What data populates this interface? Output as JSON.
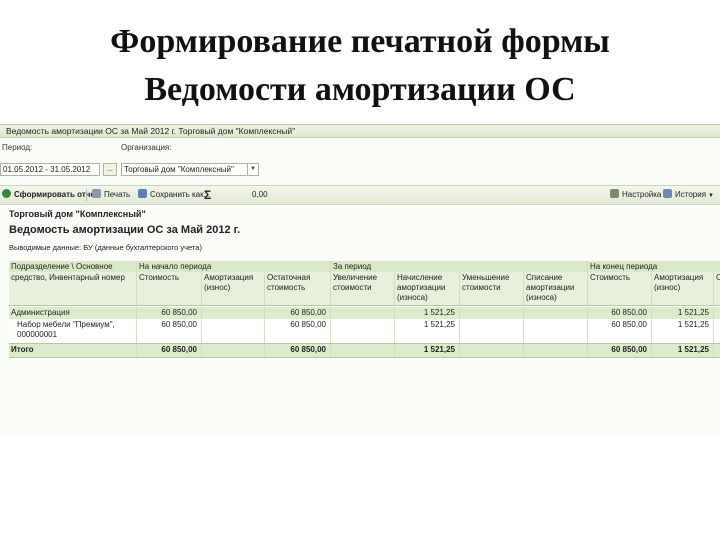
{
  "slide": {
    "title_line1": "Формирование печатной формы",
    "title_line2": "Ведомости амортизации ОС"
  },
  "window": {
    "title": "Ведомость амортизации ОС за Май 2012 г. Торговый дом \"Комплексный\""
  },
  "filters": {
    "period_label": "Период:",
    "period_value": "01.05.2012 - 31.05.2012",
    "period_button": "...",
    "org_label": "Организация:",
    "org_value": "Торговый дом \"Комплексный\""
  },
  "toolbar": {
    "generate": "Сформировать отчет",
    "print": "Печать",
    "save": "Сохранить как...",
    "sum_symbol": "Σ",
    "sum_value": "0,00",
    "settings": "Настройка",
    "history": "История"
  },
  "colors": {
    "accent_green": "#dcebc9",
    "toolbar_green": "#2f8a3a"
  },
  "report": {
    "org": "Торговый дом \"Комплексный\"",
    "title": "Ведомость амортизации ОС за Май 2012 г.",
    "output": "Выводимые данные: БУ (данные бухгалтерского учета)",
    "groups": {
      "first_col": "Подразделение \\ Основное",
      "start": "На начало периода",
      "period": "За период",
      "end": "На конец периода"
    },
    "columns": [
      "средство, Инвентарный номер",
      "Стоимость",
      "Амортизация (износ)",
      "Остаточная стоимость",
      "Увеличение стоимости",
      "Начисление амортизации (износа)",
      "Уменьшение стоимости",
      "Списание амортизации (износа)",
      "Стоимость",
      "Амортизация (износ)",
      "С"
    ],
    "rows": [
      {
        "cells": [
          "Администрация",
          "60 850,00",
          "",
          "60 850,00",
          "",
          "1 521,25",
          "",
          "",
          "60 850,00",
          "1 521,25",
          ""
        ]
      },
      {
        "cells": [
          "Набор мебели \"Премиум\", 000000001",
          "60 850,00",
          "",
          "60 850,00",
          "",
          "1 521,25",
          "",
          "",
          "60 850,00",
          "1 521,25",
          ""
        ]
      },
      {
        "cells": [
          "Итого",
          "60 850,00",
          "",
          "60 850,00",
          "",
          "1 521,25",
          "",
          "",
          "60 850,00",
          "1 521,25",
          ""
        ]
      }
    ]
  }
}
